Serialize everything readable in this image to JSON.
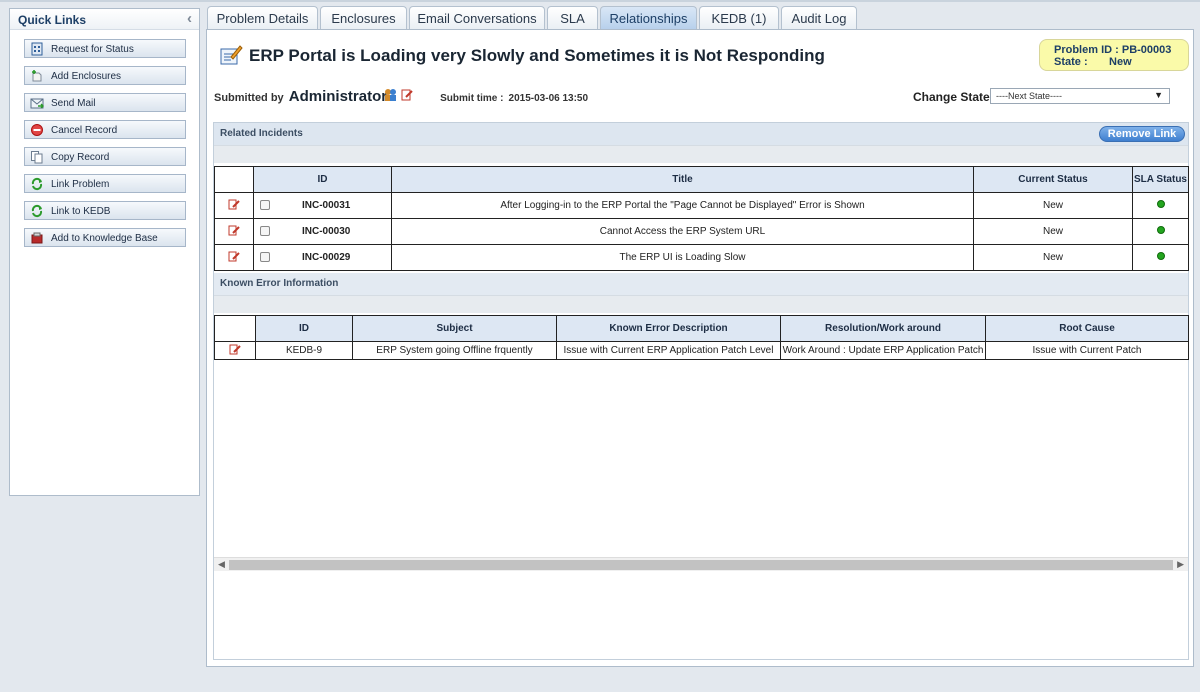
{
  "quick_links": {
    "title": "Quick Links",
    "items": [
      {
        "label": "Request for Status",
        "icon": "request-status-icon"
      },
      {
        "label": "Add Enclosures",
        "icon": "add-enclosure-icon"
      },
      {
        "label": "Send Mail",
        "icon": "send-mail-icon"
      },
      {
        "label": "Cancel Record",
        "icon": "cancel-icon"
      },
      {
        "label": "Copy Record",
        "icon": "copy-icon"
      },
      {
        "label": "Link Problem",
        "icon": "link-icon"
      },
      {
        "label": "Link to KEDB",
        "icon": "link-icon"
      },
      {
        "label": "Add to Knowledge Base",
        "icon": "knowledge-base-icon"
      }
    ]
  },
  "tabs": [
    {
      "label": "Problem Details",
      "active": false
    },
    {
      "label": "Enclosures",
      "active": false
    },
    {
      "label": "Email Conversations",
      "active": false
    },
    {
      "label": "SLA",
      "active": false
    },
    {
      "label": "Relationships",
      "active": true
    },
    {
      "label": "KEDB (1)",
      "active": false
    },
    {
      "label": "Audit Log",
      "active": false
    }
  ],
  "record": {
    "title": "ERP Portal is Loading very Slowly and Sometimes it is Not Responding",
    "problem_id_label": "Problem ID :",
    "problem_id": "PB-00003",
    "state_label": "State :",
    "state": "New",
    "submitted_by_label": "Submitted by",
    "submitted_by": "Administrator",
    "submit_time_label": "Submit time :",
    "submit_time": "2015-03-06 13:50",
    "change_state_label": "Change State :",
    "change_state_value": "----Next State----"
  },
  "related_incidents": {
    "section_title": "Related Incidents",
    "remove_link_label": "Remove Link",
    "columns": [
      "ID",
      "Title",
      "Current Status",
      "SLA Status"
    ],
    "rows": [
      {
        "id": "INC-00031",
        "title": "After Logging-in to the ERP Portal the \"Page Cannot be Displayed\" Error is Shown",
        "status": "New",
        "sla_color": "#23a51f"
      },
      {
        "id": "INC-00030",
        "title": "Cannot Access the ERP System URL",
        "status": "New",
        "sla_color": "#23a51f"
      },
      {
        "id": "INC-00029",
        "title": "The ERP UI is Loading Slow",
        "status": "New",
        "sla_color": "#23a51f"
      }
    ]
  },
  "known_error": {
    "section_title": "Known Error Information",
    "columns": [
      "ID",
      "Subject",
      "Known Error Description",
      "Resolution/Work around",
      "Root Cause"
    ],
    "rows": [
      {
        "id": "KEDB-9",
        "subject": "ERP System going Offline frquently",
        "description": "Issue with Current ERP Application Patch Level",
        "resolution": "Work Around : Update ERP Application Patch",
        "root_cause": "Issue with Current Patch"
      }
    ]
  },
  "colors": {
    "accent": "#b6cfeb",
    "badge": "#fafaa9",
    "sla_ok": "#23a51f"
  }
}
